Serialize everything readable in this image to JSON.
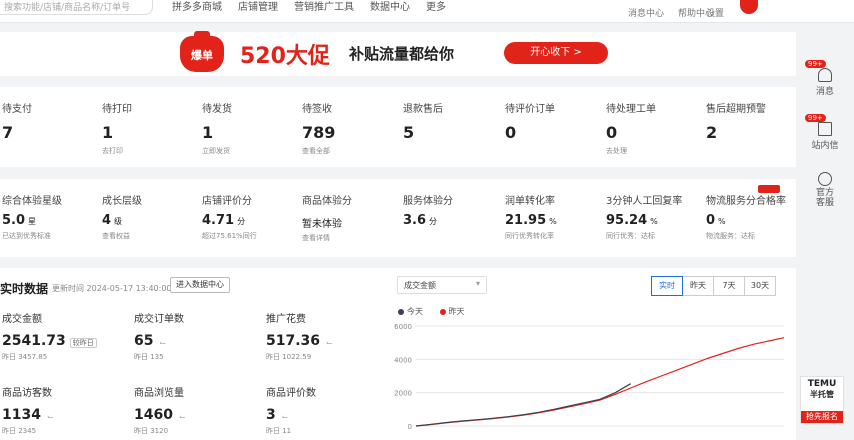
{
  "header": {
    "search_placeholder": "搜索功能/店铺/商品名称/订单号",
    "nav": [
      "拼多多商城",
      "店铺管理",
      "营销推广工具",
      "数据中心",
      "更多"
    ],
    "utils": [
      "消息中心",
      "帮助中心",
      "设置"
    ]
  },
  "banner": {
    "badge": "爆单",
    "title": "520大促",
    "subtitle": "补贴流量都给你",
    "button": "开心收下 >"
  },
  "todo": [
    {
      "label": "待支付",
      "value": "7",
      "sub": ""
    },
    {
      "label": "待打印",
      "value": "1",
      "sub": "去打印"
    },
    {
      "label": "待发货",
      "value": "1",
      "sub": "立即发货"
    },
    {
      "label": "待签收",
      "value": "789",
      "sub": "查看全部"
    },
    {
      "label": "退款售后",
      "value": "5",
      "sub": ""
    },
    {
      "label": "待评价订单",
      "value": "0",
      "sub": ""
    },
    {
      "label": "待处理工单",
      "value": "0",
      "sub": "去处理"
    },
    {
      "label": "售后超期预警",
      "value": "2",
      "sub": ""
    }
  ],
  "metrics": [
    {
      "label": "综合体验星级",
      "value": "5.0",
      "unit": "星",
      "sub": "已达到优秀标准"
    },
    {
      "label": "成长层级",
      "value": "4",
      "unit": "级",
      "sub": "查看权益"
    },
    {
      "label": "店铺评价分",
      "value": "4.71",
      "unit": "分",
      "sub": "超过75.61%同行"
    },
    {
      "label": "商品体验分",
      "value": "暂未体验",
      "unit": "",
      "sub": "查看详情"
    },
    {
      "label": "服务体验分",
      "value": "3.6",
      "unit": "分",
      "sub": ""
    },
    {
      "label": "润单转化率",
      "value": "21.95",
      "unit": "%",
      "sub": "同行优秀转化率"
    },
    {
      "label": "3分钟人工回复率",
      "value": "95.24",
      "unit": "%",
      "sub": "同行优秀：达标"
    },
    {
      "label": "物流服务分合格率",
      "value": "0",
      "unit": "%",
      "sub": "物流服务：达标"
    }
  ],
  "realtime": {
    "title": "实时数据",
    "updated": "更新时间 2024-05-17 13:40:00",
    "center_button": "进入数据中心",
    "selector": "成交金额",
    "tabs": [
      "实时",
      "昨天",
      "7天",
      "30天"
    ],
    "active_tab": "实时",
    "cards": [
      {
        "label": "成交金额",
        "value": "2541.73",
        "chip": "较昨日",
        "sub": "昨日 3457.85"
      },
      {
        "label": "成交订单数",
        "value": "65",
        "chip": "",
        "sub": "昨日 135"
      },
      {
        "label": "推广花费",
        "value": "517.36",
        "chip": "",
        "sub": "昨日 1022.59"
      },
      {
        "label": "商品访客数",
        "value": "1134",
        "chip": "",
        "sub": "昨日 2345"
      },
      {
        "label": "商品浏览量",
        "value": "1460",
        "chip": "",
        "sub": "昨日 3120"
      },
      {
        "label": "商品评价数",
        "value": "3",
        "chip": "",
        "sub": "昨日 11"
      }
    ]
  },
  "sidebar": {
    "items": [
      {
        "label": "消息",
        "badge": "99+",
        "icon": "bell-icon"
      },
      {
        "label": "站内信",
        "badge": "99+",
        "icon": "mail-icon"
      },
      {
        "label": "官方客服",
        "badge": "",
        "icon": "service-robot-icon"
      }
    ]
  },
  "temu": {
    "line1": "TEMU",
    "line2": "半托管",
    "line3": "抢先报名"
  },
  "chart_data": {
    "type": "line",
    "legend": [
      "今天",
      "昨天"
    ],
    "colors": {
      "today": "#3a3f51",
      "yesterday": "#e2231a"
    },
    "ylim": [
      0,
      6000
    ],
    "yticks": [
      "0",
      "2000",
      "4000",
      "6000"
    ],
    "x": [
      0,
      1,
      2,
      3,
      4,
      5,
      6,
      7,
      8,
      9,
      10,
      11,
      12,
      13,
      14,
      15,
      16,
      17,
      18,
      19,
      20,
      21,
      22,
      23,
      24
    ],
    "series": [
      {
        "name": "今天",
        "values": [
          0,
          100,
          210,
          300,
          380,
          460,
          560,
          680,
          820,
          1000,
          1200,
          1400,
          1600,
          2000,
          2540
        ]
      },
      {
        "name": "昨天",
        "values": [
          0,
          90,
          190,
          280,
          360,
          440,
          540,
          650,
          790,
          960,
          1150,
          1350,
          1560,
          1900,
          2280,
          2650,
          3000,
          3350,
          3700,
          4050,
          4350,
          4650,
          4900,
          5100,
          5300
        ]
      }
    ]
  }
}
